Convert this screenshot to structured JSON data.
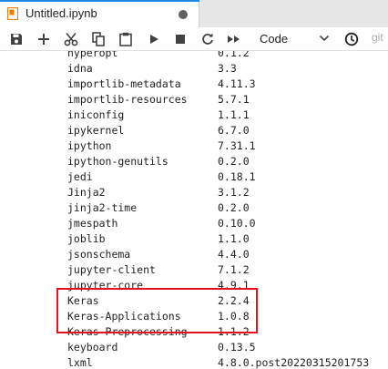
{
  "tab": {
    "title": "Untitled.ipynb"
  },
  "toolbar": {
    "buttons": [
      "save-icon",
      "add-cell-icon",
      "cut-icon",
      "copy-icon",
      "paste-icon",
      "run-icon",
      "stop-icon",
      "restart-icon",
      "fast-forward-icon"
    ],
    "cell_type": "Code",
    "git_label": "git"
  },
  "colors": {
    "accent": "#1e88e5",
    "highlight_border": "#e8101d",
    "tab_icon": "#f57c00"
  },
  "packages": [
    {
      "name": "hyperopt",
      "version": "0.1.2"
    },
    {
      "name": "idna",
      "version": "3.3"
    },
    {
      "name": "importlib-metadata",
      "version": "4.11.3"
    },
    {
      "name": "importlib-resources",
      "version": "5.7.1"
    },
    {
      "name": "iniconfig",
      "version": "1.1.1"
    },
    {
      "name": "ipykernel",
      "version": "6.7.0"
    },
    {
      "name": "ipython",
      "version": "7.31.1"
    },
    {
      "name": "ipython-genutils",
      "version": "0.2.0"
    },
    {
      "name": "jedi",
      "version": "0.18.1"
    },
    {
      "name": "Jinja2",
      "version": "3.1.2"
    },
    {
      "name": "jinja2-time",
      "version": "0.2.0"
    },
    {
      "name": "jmespath",
      "version": "0.10.0"
    },
    {
      "name": "joblib",
      "version": "1.1.0"
    },
    {
      "name": "jsonschema",
      "version": "4.4.0"
    },
    {
      "name": "jupyter-client",
      "version": "7.1.2"
    },
    {
      "name": "jupyter-core",
      "version": "4.9.1"
    },
    {
      "name": "Keras",
      "version": "2.2.4"
    },
    {
      "name": "Keras-Applications",
      "version": "1.0.8"
    },
    {
      "name": "Keras-Preprocessing",
      "version": "1.1.2"
    },
    {
      "name": "keyboard",
      "version": "0.13.5"
    },
    {
      "name": "lxml",
      "version": "4.8.0.post20220315201753"
    }
  ]
}
